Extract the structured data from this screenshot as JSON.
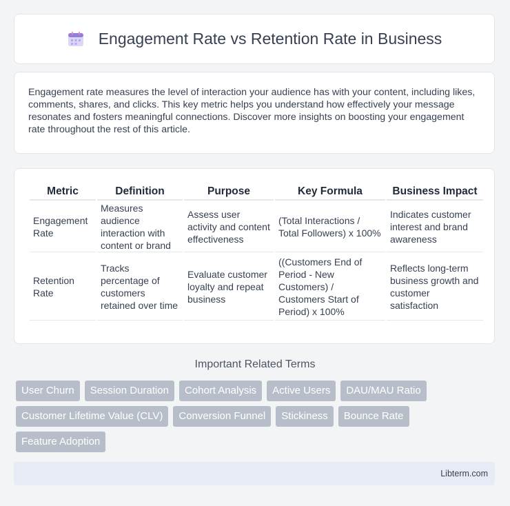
{
  "header": {
    "title": "Engagement Rate vs Retention Rate in Business",
    "icon": "calendar-icon"
  },
  "intro": {
    "text": "Engagement rate measures the level of interaction your audience has with your content, including likes, comments, shares, and clicks. This key metric helps you understand how effectively your message resonates and fosters meaningful connections. Discover more insights on boosting your engagement rate throughout the rest of this article."
  },
  "table": {
    "headers": [
      "Metric",
      "Definition",
      "Purpose",
      "Key Formula",
      "Business Impact"
    ],
    "rows": [
      [
        "Engagement Rate",
        "Measures audience interaction with content or brand",
        "Assess user activity and content effectiveness",
        "(Total Interactions / Total Followers) x 100%",
        "Indicates customer interest and brand awareness"
      ],
      [
        "Retention Rate",
        "Tracks percentage of customers retained over time",
        "Evaluate customer loyalty and repeat business",
        "((Customers End of Period - New Customers) / Customers Start of Period) x 100%",
        "Reflects long-term business growth and customer satisfaction"
      ]
    ]
  },
  "related": {
    "heading": "Important Related Terms",
    "terms": [
      "User Churn",
      "Session Duration",
      "Cohort Analysis",
      "Active Users",
      "DAU/MAU Ratio",
      "Customer Lifetime Value (CLV)",
      "Conversion Funnel",
      "Stickiness",
      "Bounce Rate",
      "Feature Adoption"
    ]
  },
  "footer": {
    "text": "Libterm.com"
  }
}
